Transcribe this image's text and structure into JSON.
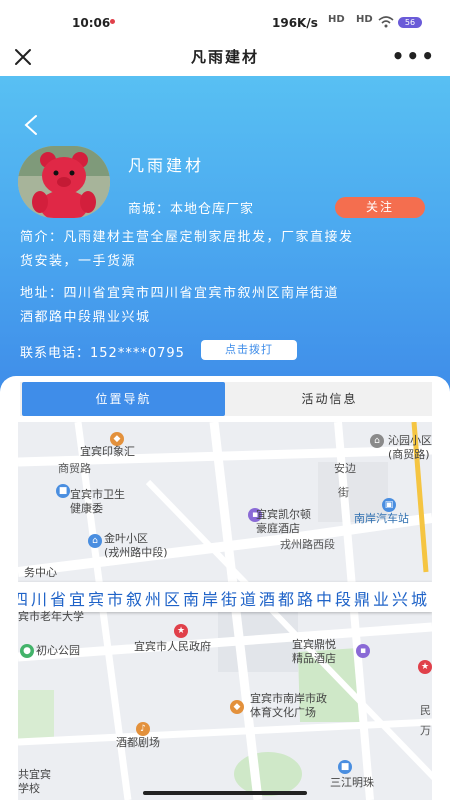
{
  "status_bar": {
    "time": "10:06",
    "net_speed": "196K/s",
    "sig_hd1": "HD",
    "sig_hd2": "HD",
    "battery": "56"
  },
  "title_bar": {
    "title": "凡雨建材"
  },
  "shop": {
    "name": "凡雨建材",
    "type": "商城：本地仓库厂家",
    "follow_label": "关注",
    "intro_line1": "简介：凡雨建材主营全屋定制家居批发，厂家直接发",
    "intro_line2": "货安装，一手货源",
    "address_line1": "地址：四川省宜宾市四川省宜宾市叙州区南岸街道",
    "address_line2": "酒都路中段鼎业兴城",
    "phone_label": "联系电话：",
    "phone_number": "152****0795",
    "call_label": "点击拨打"
  },
  "tabs": [
    {
      "label": "位置导航",
      "active": true
    },
    {
      "label": "活动信息",
      "active": false
    }
  ],
  "map": {
    "address_banner": "四川省宜宾市叙州区南岸街道酒都路中段鼎业兴城",
    "labels": {
      "l01": "宜宾印象汇",
      "l02": "商贸路",
      "l03": "宜宾市卫生",
      "l04": "健康委",
      "l05": "金叶小区",
      "l06": "(戎州路中段)",
      "l07": "务中心",
      "l08": "宜宾凯尔顿",
      "l09": "豪庭酒店",
      "l10": "安边",
      "l11": "街",
      "l12": "沁园小区",
      "l13": "(商贸路)",
      "l14": "南岸汽车站",
      "l15": "戎州路西段",
      "l16": "宾市老年大学",
      "l17": "初心公园",
      "l18": "宜宾市人民政府",
      "l19": "宜宾鼎悦",
      "l20": "精品酒店",
      "l21": "宜宾市南岸市政",
      "l22": "体育文化广场",
      "l23": "酒都剧场",
      "l24": "共宜宾",
      "l25": "学校",
      "l26": "三江明珠",
      "l27": "民",
      "l28": "万"
    }
  },
  "colors": {
    "hero_top": "#58c0f3",
    "hero_bottom": "#3f8de9",
    "follow": "#f46e4f",
    "accent": "#3f8de9"
  }
}
